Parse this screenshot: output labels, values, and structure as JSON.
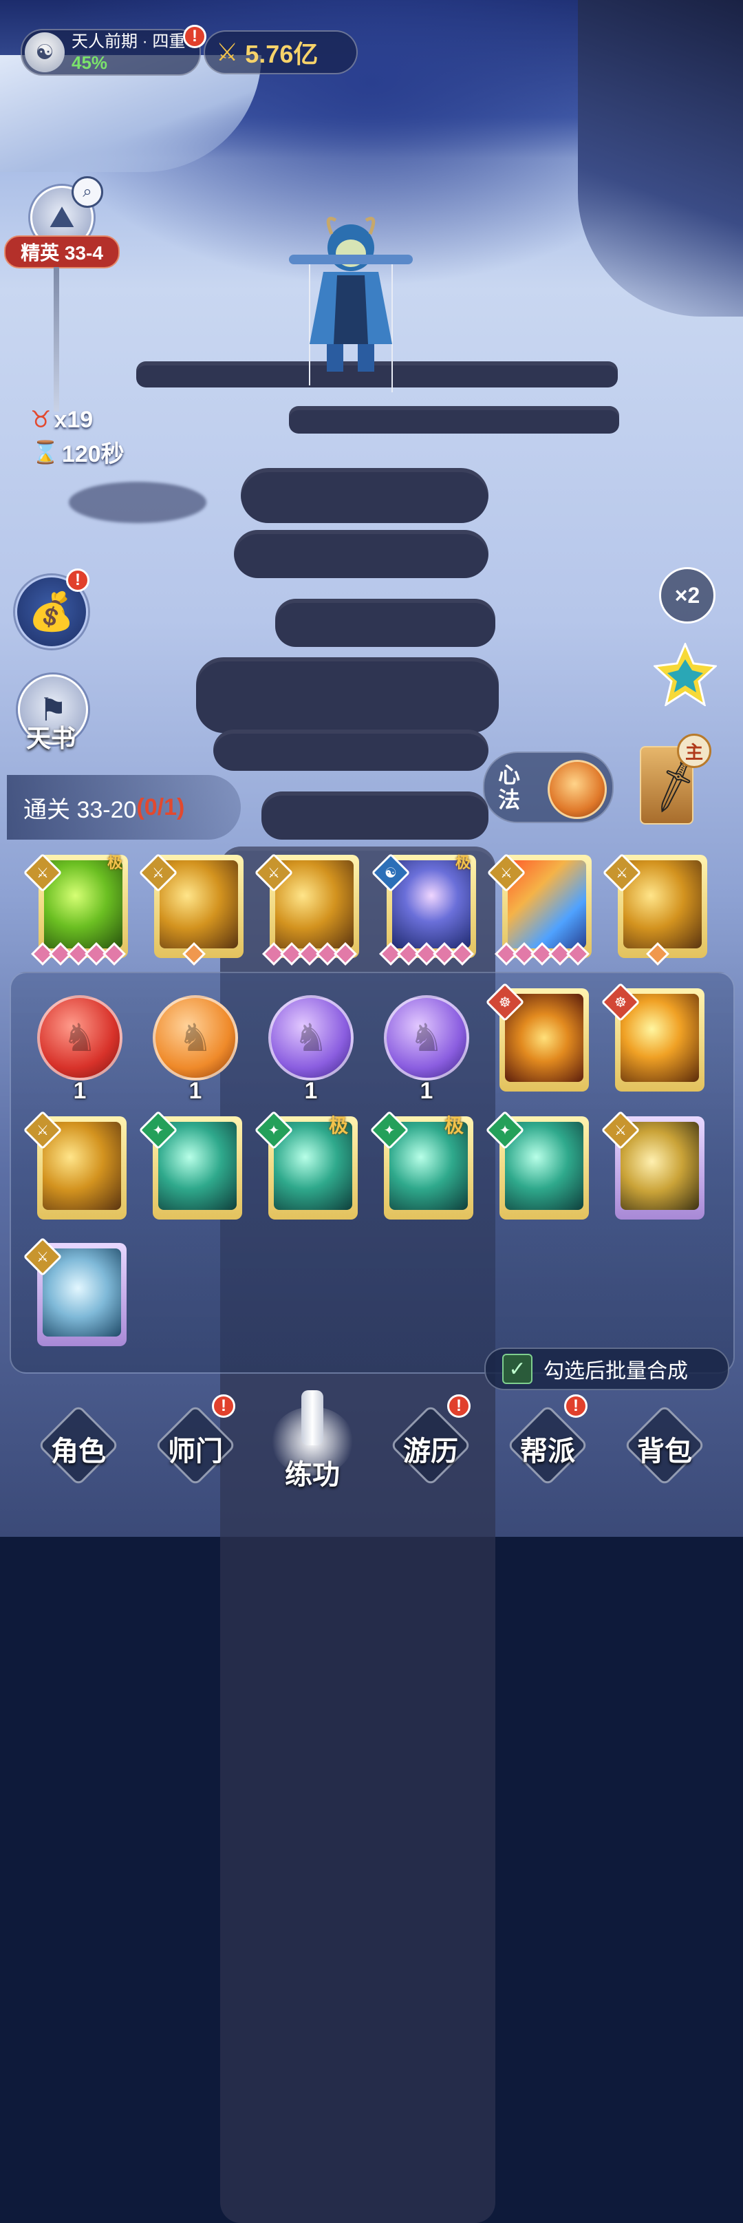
{
  "header": {
    "realm_label": "天人前期 · 四重",
    "realm_progress": "45%",
    "power_value": "5.76亿",
    "notify_badge": "!"
  },
  "stage": {
    "elite_label": "精英 33-4",
    "enemy_count": "x19",
    "timer": "120秒"
  },
  "left_buttons": {
    "gift_badge": "!",
    "tianshu_label": "天书"
  },
  "right_buttons": {
    "speed_label": "×2",
    "main_tag": "主",
    "xinfa_label": "心法"
  },
  "quest": {
    "label": "通关 33-20",
    "progress": "(0/1)"
  },
  "equipped_skills": [
    {
      "art": "green",
      "tag": "极",
      "gems": 5
    },
    {
      "art": "yellow",
      "tag": "",
      "gems": 1
    },
    {
      "art": "yellow",
      "tag": "",
      "gems": 5
    },
    {
      "art": "blue",
      "tag": "极",
      "gems": 5
    },
    {
      "art": "fire",
      "tag": "",
      "gems": 5
    },
    {
      "art": "yellow",
      "tag": "",
      "gems": 1
    }
  ],
  "inventory": {
    "orbs": [
      {
        "color": "red",
        "count": "1"
      },
      {
        "color": "orange",
        "count": "1"
      },
      {
        "color": "purple",
        "count": "1"
      },
      {
        "color": "purple",
        "count": "1"
      }
    ],
    "cards_row1": [
      {
        "art": "lotus",
        "frame": "gold",
        "marker": "red"
      },
      {
        "art": "orb",
        "frame": "gold",
        "marker": "red"
      }
    ],
    "cards_row2": [
      {
        "art": "yellow",
        "frame": "gold",
        "marker": "gold",
        "tag": ""
      },
      {
        "art": "teal",
        "frame": "gold",
        "marker": "green",
        "tag": ""
      },
      {
        "art": "teal",
        "frame": "gold",
        "marker": "green",
        "tag": "极"
      },
      {
        "art": "teal",
        "frame": "gold",
        "marker": "green",
        "tag": "极"
      },
      {
        "art": "teal",
        "frame": "gold",
        "marker": "green",
        "tag": ""
      },
      {
        "art": "gale",
        "frame": "purple",
        "marker": "gold",
        "tag": ""
      }
    ],
    "cards_row3": [
      {
        "art": "water",
        "frame": "purple",
        "marker": "gold",
        "tag": ""
      }
    ]
  },
  "batch_merge": {
    "label": "勾选后批量合成",
    "checked": true
  },
  "bottom_nav": [
    {
      "label": "角色",
      "badge": ""
    },
    {
      "label": "师门",
      "badge": "!"
    },
    {
      "label": "练功",
      "badge": ""
    },
    {
      "label": "游历",
      "badge": "!"
    },
    {
      "label": "帮派",
      "badge": "!"
    },
    {
      "label": "背包",
      "badge": ""
    }
  ]
}
